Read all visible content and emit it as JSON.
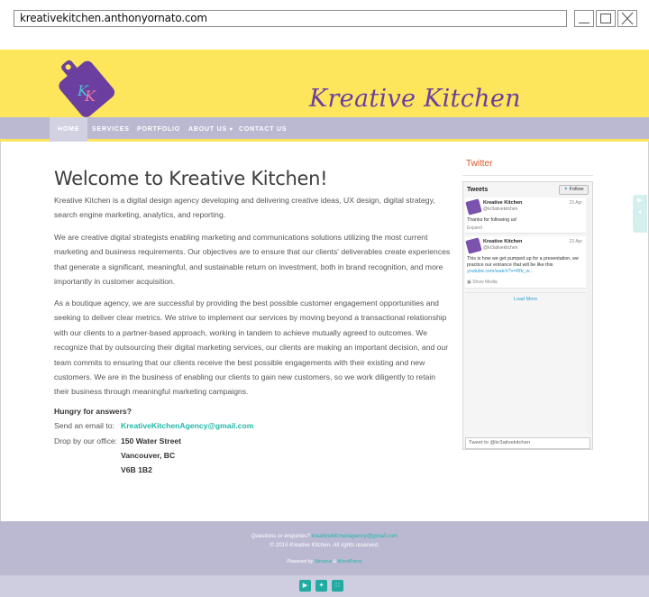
{
  "browser": {
    "url": "kreativekitchen.anthonyornato.com"
  },
  "header": {
    "logo_letters": "KK",
    "brand": "Kreative Kitchen"
  },
  "nav": {
    "items": [
      {
        "label": "HOME"
      },
      {
        "label": "SERVICES"
      },
      {
        "label": "PORTFOLIO"
      },
      {
        "label": "ABOUT US",
        "has_dropdown": true
      },
      {
        "label": "CONTACT US"
      }
    ]
  },
  "main": {
    "title": "Welcome to Kreative Kitchen!",
    "p1": "Kreative Kitchen is a digital design agency developing and delivering creative ideas, UX design, digital strategy, search engine marketing, analytics, and reporting.",
    "p2": "We are creative digital strategists enabling marketing and communications solutions utilizing the most current marketing and business requirements. Our objectives are to ensure that our clients' deliverables create experiences that generate a significant, meaningful, and sustainable return on investment, both in brand recognition, and more importantly in customer acquisition.",
    "p3": "As a boutique agency, we are successful by providing the best possible customer engagement opportunities and seeking to deliver clear metrics. We strive to implement our services by moving beyond a transactional relationship with our clients to a partner-based approach, working in tandem to achieve mutually agreed to outcomes. We recognize that by outsourcing their digital marketing services, our clients are making an important decision, and our team commits to ensuring that our clients receive the best possible engagements with their existing and new customers. We are in the business of enabling our clients to gain new customers, so we work diligently to retain their business through meaningful marketing campaigns.",
    "contact": {
      "heading": "Hungry for answers?",
      "email_label": "Send an email to:",
      "email": "KreativeKitchenAgency@gmail.com",
      "office_label": "Drop by our office:",
      "address_line1": "150 Water Street",
      "address_line2": "Vancouver, BC",
      "address_line3": "V6B 1B2"
    }
  },
  "twitter": {
    "heading": "Twitter",
    "widget_title": "Tweets",
    "follow_label": "Follow",
    "tweets": [
      {
        "name": "Kreative Kitchen",
        "handle": "@kr3ativekitchen",
        "date": "23 Apr",
        "text": "Thanks for following us!",
        "action": "Expand"
      },
      {
        "name": "Kreative Kitchen",
        "handle": "@kr3ativekitchen",
        "date": "23 Apr",
        "text": "This is how we get pumped up for a presentation, we practice our entrance that will be like this",
        "link": "youtube.com/watch?v=Rfb_w...",
        "action": "Show Media"
      }
    ],
    "load_more": "Load More",
    "tweet_placeholder": "Tweet to @kr3ativekitchen"
  },
  "footer": {
    "question": "Questions or enquiries?",
    "email": "kreativekitchenagency@gmail.com",
    "copyright": "© 2015 Kreative Kitchen. All rights reserved.",
    "powered_by": "Powered by",
    "powered_link1": "Nirvana",
    "powered_sep": "&",
    "powered_link2": "WordPress"
  },
  "colors": {
    "header_yellow": "#fde55c",
    "nav_lavender": "#bbb9d2",
    "brand_purple": "#6a3fa0",
    "accent_teal": "#22b8a8",
    "twitter_heading": "#d9552a"
  },
  "icons": [
    "youtube-icon",
    "twitter-icon",
    "rss-icon"
  ]
}
